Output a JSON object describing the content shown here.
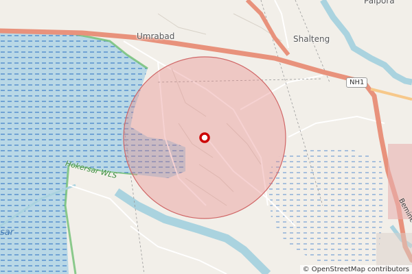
{
  "places": {
    "umrabad": "Umrabad",
    "shalteng": "Shalteng",
    "palpora": "Palpora"
  },
  "road_shield": "NH1",
  "wetland_label": "Hokersar WLS",
  "lake_label_fragment": "sar",
  "road_label_fragment": "Bemine",
  "attribution": "© OpenStreetMap contributors",
  "colors": {
    "land": "#f2efe9",
    "water": "#aad3df",
    "highway": "#e8927c",
    "radius_fill": "#e88a8a",
    "marker": "#cc0000",
    "protected_area": "#6fbf73"
  }
}
